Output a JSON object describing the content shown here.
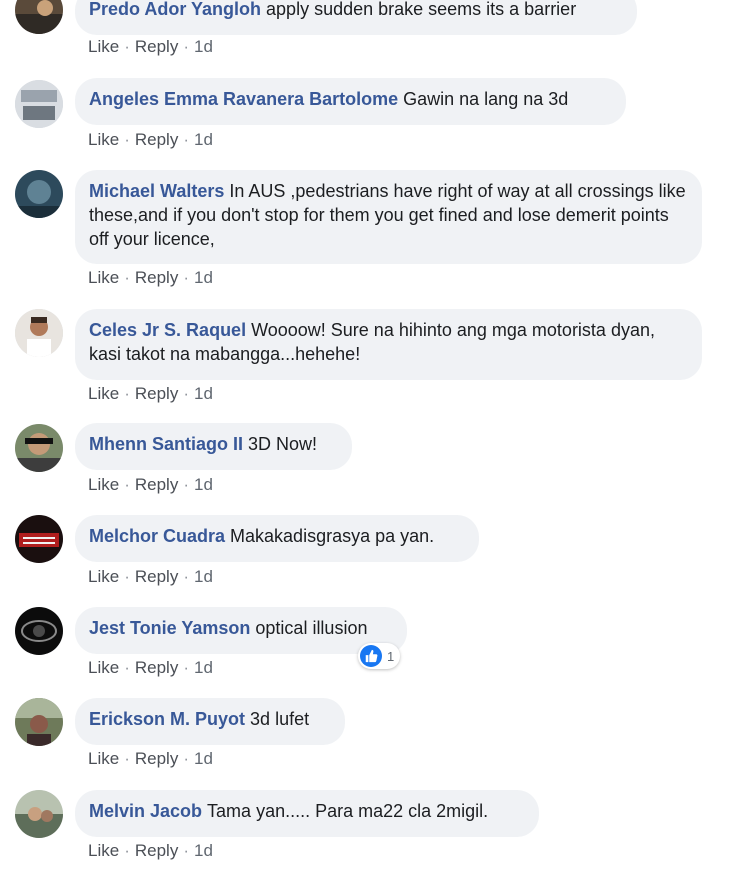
{
  "comments": [
    {
      "author": "Predo Ador Yangloh",
      "text": "apply sudden brake seems its a barrier",
      "like": "Like",
      "reply": "Reply",
      "time": "1d"
    },
    {
      "author": "Angeles Emma Ravanera Bartolome",
      "text": "Gawin na lang na 3d",
      "like": "Like",
      "reply": "Reply",
      "time": "1d"
    },
    {
      "author": "Michael Walters",
      "text": "In AUS ,pedestrians have right of way at all crossings like these,and if you don't stop for them you get fined and lose demerit points off your licence,",
      "like": "Like",
      "reply": "Reply",
      "time": "1d"
    },
    {
      "author": "Celes Jr S. Raquel",
      "text": "Woooow! Sure na hihinto ang mga motorista dyan, kasi takot na mabangga...hehehe!",
      "like": "Like",
      "reply": "Reply",
      "time": "1d"
    },
    {
      "author": "Mhenn Santiago II",
      "text": "3D Now!",
      "like": "Like",
      "reply": "Reply",
      "time": "1d"
    },
    {
      "author": "Melchor Cuadra",
      "text": "Makakadisgrasya pa yan.",
      "like": "Like",
      "reply": "Reply",
      "time": "1d"
    },
    {
      "author": "Jest Tonie Yamson",
      "text": "optical illusion",
      "like": "Like",
      "reply": "Reply",
      "time": "1d",
      "reaction_count": "1"
    },
    {
      "author": "Erickson M. Puyot",
      "text": "3d lufet",
      "like": "Like",
      "reply": "Reply",
      "time": "1d"
    },
    {
      "author": "Melvin Jacob",
      "text": "Tama yan..... Para ma22 cla 2migil.",
      "like": "Like",
      "reply": "Reply",
      "time": "1d"
    }
  ],
  "colors": {
    "author": "#385898",
    "bubble": "#f0f2f5",
    "meta": "#606770",
    "like_reaction": "#1877f2"
  },
  "icons": {
    "reaction": "thumbs-up-icon"
  }
}
